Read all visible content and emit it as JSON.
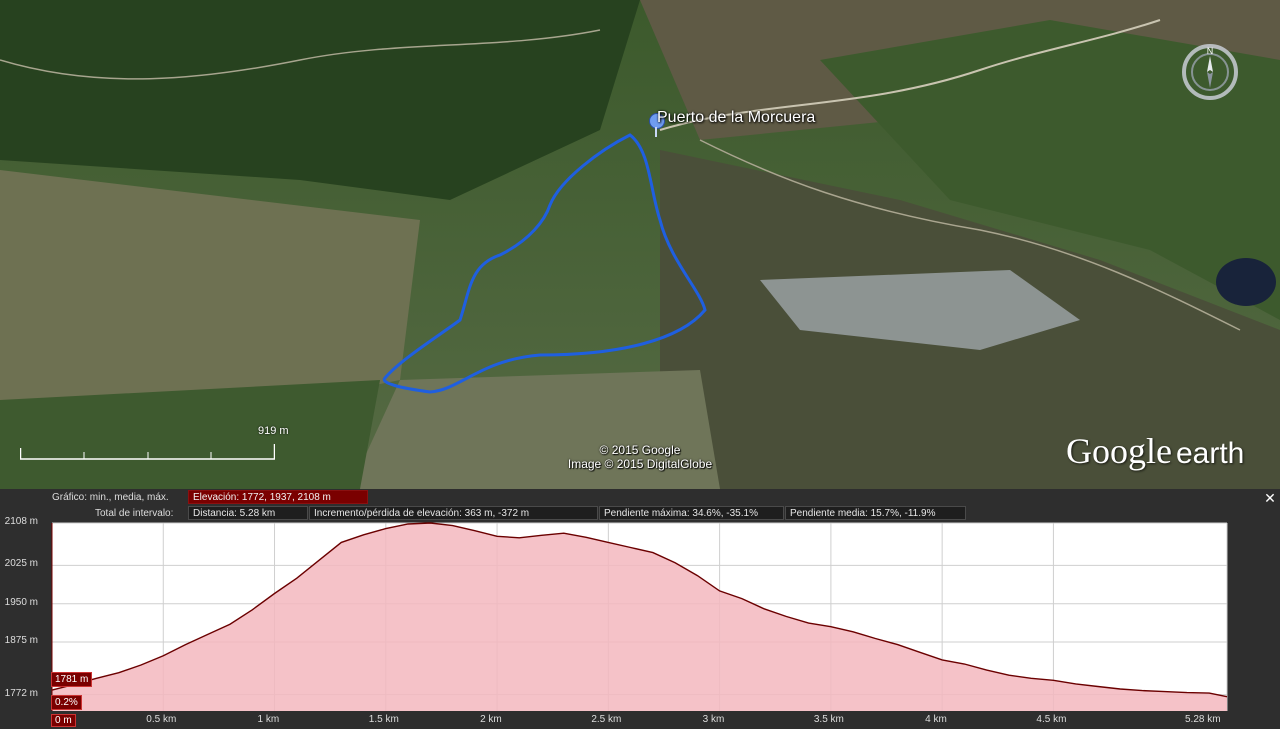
{
  "map": {
    "placemark": "Puerto de la Morcuera",
    "scale_label": "919 m",
    "credits": [
      "© 2015 Google",
      "Image © 2015 DigitalGlobe"
    ],
    "logo": {
      "google": "Google",
      "earth": "earth"
    },
    "compass_letter": "N",
    "track_color": "#1f5fe0"
  },
  "profile": {
    "graph_label": "Gráfico: min., media, máx.",
    "elevation_stat": "Elevación: 1772, 1937, 2108 m",
    "interval_label": "Total de intervalo:",
    "distance_stat": "Distancia: 5.28 km",
    "gain_loss_stat": "Incremento/pérdida de elevación: 363 m, -372 m",
    "max_slope_stat": "Pendiente máxima: 34.6%, -35.1%",
    "avg_slope_stat": "Pendiente media: 15.7%, -11.9%",
    "close_symbol": "✕",
    "cursor_elevation": "1781 m",
    "cursor_slope": "0.2%",
    "cursor_distance": "0 m",
    "accent_color": "#7a0000"
  },
  "chart_data": {
    "type": "area",
    "x": [
      0,
      0.1,
      0.2,
      0.3,
      0.4,
      0.5,
      0.6,
      0.7,
      0.8,
      0.9,
      1.0,
      1.1,
      1.2,
      1.3,
      1.4,
      1.5,
      1.6,
      1.7,
      1.8,
      1.9,
      2.0,
      2.1,
      2.2,
      2.3,
      2.4,
      2.5,
      2.6,
      2.7,
      2.8,
      2.9,
      3.0,
      3.1,
      3.2,
      3.3,
      3.4,
      3.5,
      3.6,
      3.7,
      3.8,
      3.9,
      4.0,
      4.1,
      4.2,
      4.3,
      4.4,
      4.5,
      4.6,
      4.7,
      4.8,
      4.9,
      5.0,
      5.1,
      5.2,
      5.28
    ],
    "y": [
      1781,
      1792,
      1804,
      1815,
      1830,
      1848,
      1870,
      1890,
      1910,
      1938,
      1970,
      2000,
      2035,
      2070,
      2085,
      2097,
      2106,
      2108,
      2103,
      2093,
      2082,
      2079,
      2084,
      2088,
      2080,
      2070,
      2060,
      2050,
      2030,
      2005,
      1975,
      1960,
      1940,
      1925,
      1912,
      1905,
      1895,
      1882,
      1870,
      1855,
      1840,
      1832,
      1820,
      1810,
      1804,
      1800,
      1793,
      1788,
      1783,
      1780,
      1778,
      1776,
      1775,
      1768
    ],
    "xlabel": "",
    "ylabel": "",
    "x_ticks": [
      "0 m",
      "0.5 km",
      "1 km",
      "1.5 km",
      "2 km",
      "2.5 km",
      "3 km",
      "3.5 km",
      "4 km",
      "4.5 km",
      "5.28 km"
    ],
    "y_ticks": [
      "2108 m",
      "2025 m",
      "1950 m",
      "1875 m",
      "1772 m"
    ],
    "xlim": [
      0,
      5.28
    ],
    "ylim": [
      1740,
      2108
    ],
    "grid": true,
    "fill_color": "#f3b7be",
    "line_color": "#6b0000"
  }
}
